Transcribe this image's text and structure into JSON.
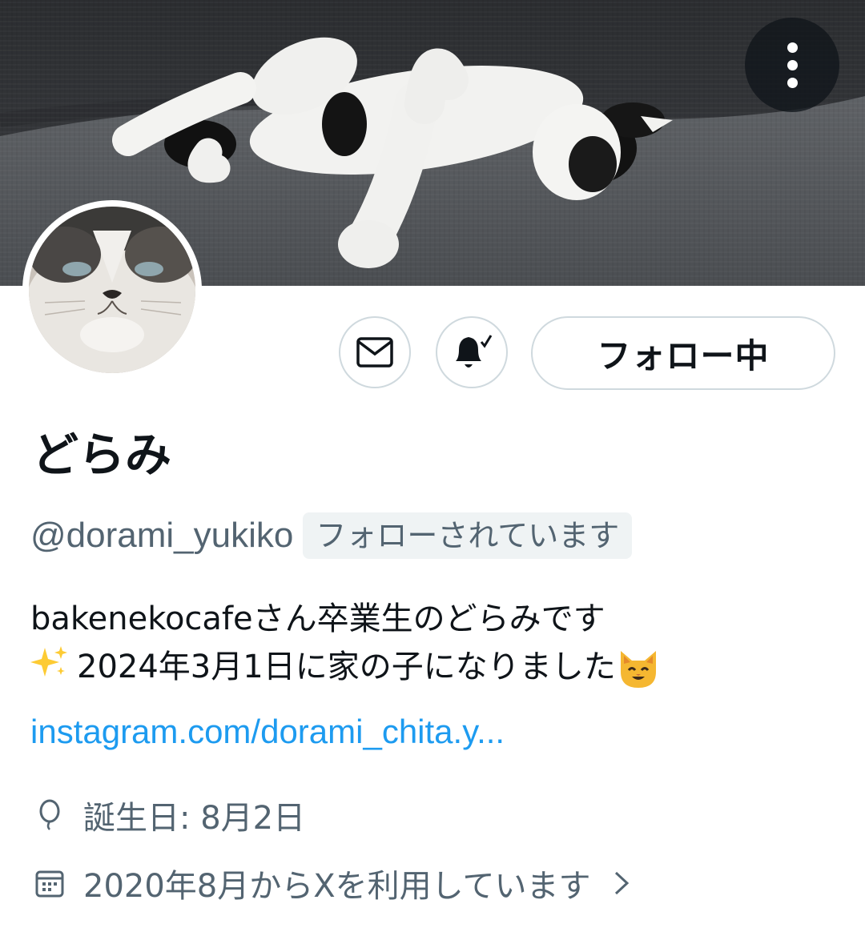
{
  "header": {
    "more_icon": "more-vertical-icon"
  },
  "profile": {
    "display_name": "どらみ",
    "handle": "@dorami_yukiko",
    "follows_you_badge": "フォローされています",
    "follow_button_label": "フォロー中"
  },
  "actions": {
    "message_icon": "envelope-icon",
    "notify_icon": "bell-check-icon"
  },
  "bio": {
    "line1": "bakenekocafeさん卒業生のどらみです",
    "line2": "2024年3月1日に家の子になりました",
    "link": "instagram.com/dorami_chita.y..."
  },
  "meta": {
    "birthday": "誕生日: 8月2日",
    "joined": "2020年8月からXを利用しています"
  },
  "colors": {
    "text": "#0f1419",
    "secondary": "#536471",
    "link": "#1d9bf0",
    "border": "#cfd9de"
  }
}
